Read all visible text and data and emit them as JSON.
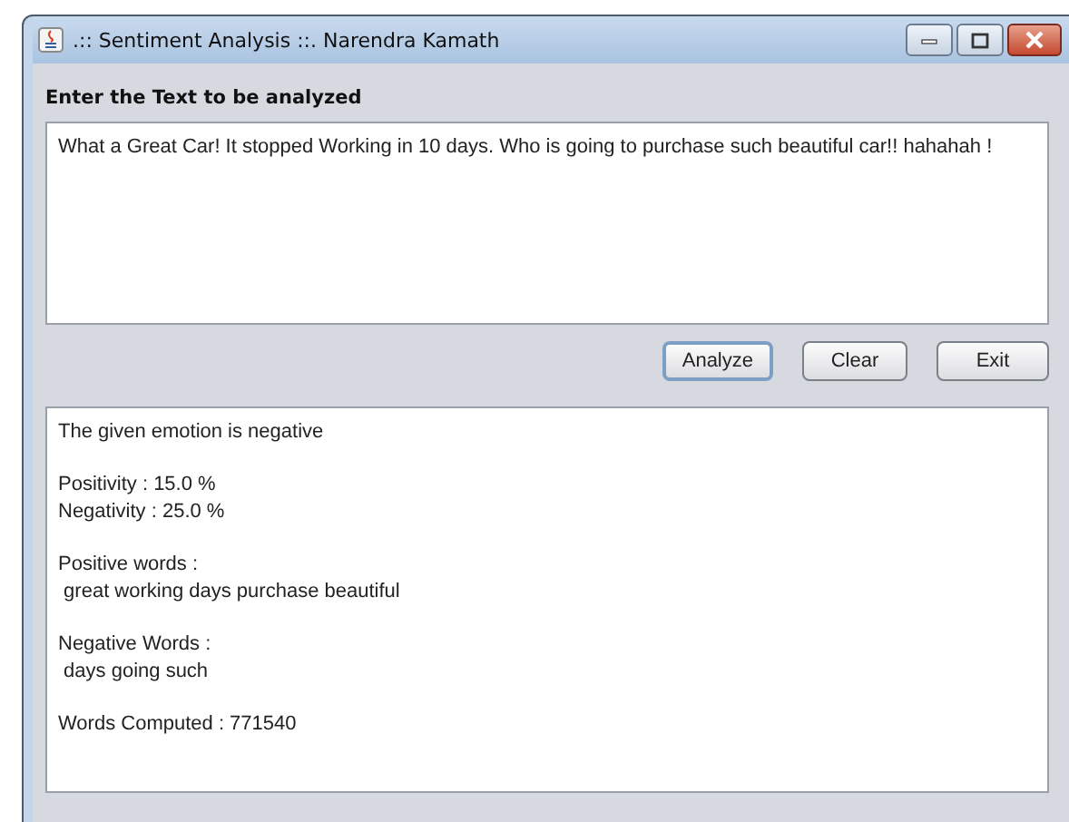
{
  "window": {
    "title": ".:: Sentiment Analysis ::. Narendra Kamath"
  },
  "input": {
    "label": "Enter the Text to be analyzed",
    "value": "What a Great Car! It stopped Working in 10 days. Who is going to purchase such beautiful car!! hahahah !"
  },
  "buttons": [
    {
      "label": "Analyze",
      "focused": true
    },
    {
      "label": "Clear",
      "focused": false
    },
    {
      "label": "Exit",
      "focused": false
    }
  ],
  "output": {
    "paragraphs": [
      [
        "The given emotion is negative"
      ],
      [
        "Positivity : 15.0 %",
        "Negativity : 25.0 %"
      ],
      [
        "Positive words :",
        " great working days purchase beautiful"
      ],
      [
        "Negative Words :",
        " days going such"
      ],
      [
        "Words Computed : 771540"
      ]
    ]
  }
}
